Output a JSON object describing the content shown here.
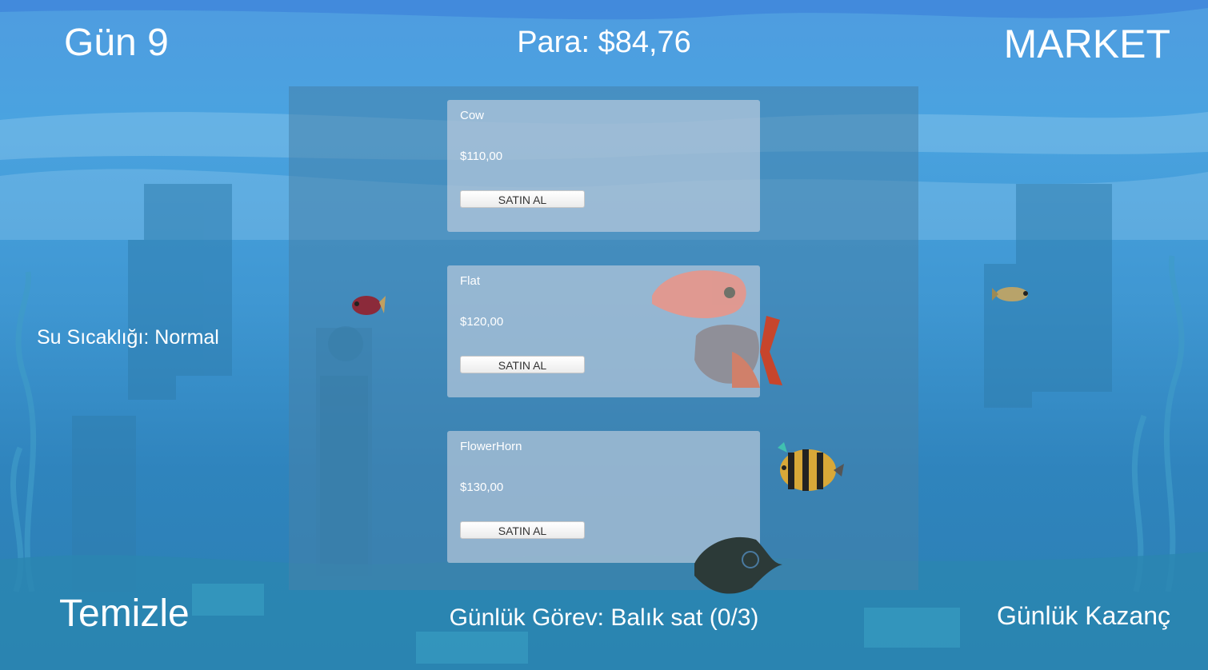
{
  "hud": {
    "day": "Gün 9",
    "money": "Para: $84,76",
    "market": "MARKET",
    "water_temp": "Su Sıcaklığı: Normal",
    "clean": "Temizle",
    "daily_task": "Günlük Görev: Balık sat (0/3)",
    "daily_earnings": "Günlük Kazanç"
  },
  "market": {
    "items": [
      {
        "name": "Cow",
        "price": "$110,00",
        "buy_label": "SATIN AL"
      },
      {
        "name": "Flat",
        "price": "$120,00",
        "buy_label": "SATIN AL"
      },
      {
        "name": "FlowerHorn",
        "price": "$130,00",
        "buy_label": "SATIN AL"
      }
    ]
  }
}
